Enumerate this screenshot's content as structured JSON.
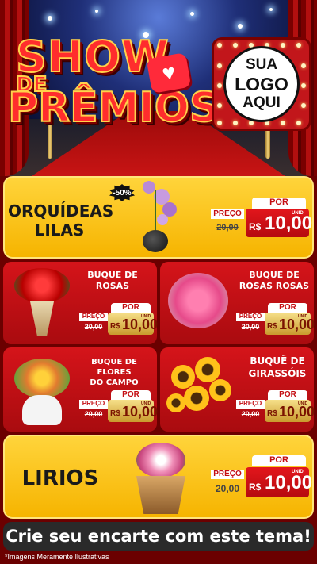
{
  "header": {
    "title_show": "SHOW",
    "title_de": "DE",
    "title_premios": "PRÊMIOS",
    "logo_line1": "SUA",
    "logo_line2": "LOGO",
    "logo_line3": "AQUI",
    "icon": "heart-icon"
  },
  "products": [
    {
      "name_line1": "ORQUÍDEAS",
      "name_line2": "LILAS",
      "discount": "-50%",
      "preco_label": "PREÇO",
      "old_price": "20,00",
      "por_label": "POR",
      "currency": "R$",
      "price": "10,00",
      "unit": "UNID"
    },
    {
      "name_line1": "BUQUE DE",
      "name_line2": "ROSAS",
      "preco_label": "PREÇO",
      "old_price": "20,00",
      "por_label": "POR",
      "currency": "R$",
      "price": "10,00",
      "unit": "UNID"
    },
    {
      "name_line1": "BUQUE DE",
      "name_line2": "ROSAS ROSAS",
      "preco_label": "PREÇO",
      "old_price": "20,00",
      "por_label": "POR",
      "currency": "R$",
      "price": "10,00",
      "unit": "UNID"
    },
    {
      "name_line1": "BUQUE DE FLORES",
      "name_line2": "DO CAMPO",
      "preco_label": "PREÇO",
      "old_price": "20,00",
      "por_label": "POR",
      "currency": "R$",
      "price": "10,00",
      "unit": "UNID"
    },
    {
      "name_line1": "BUQUÊ DE",
      "name_line2": "GIRASSÓIS",
      "preco_label": "PREÇO",
      "old_price": "20,00",
      "por_label": "POR",
      "currency": "R$",
      "price": "10,00",
      "unit": "UNID"
    },
    {
      "name_line1": "LIRIOS",
      "preco_label": "PREÇO",
      "old_price": "20,00",
      "por_label": "POR",
      "currency": "R$",
      "price": "10,00",
      "unit": "UNID"
    }
  ],
  "footer": {
    "cta": "Crie seu encarte com este tema!",
    "disclaimer": "*Imagens Meramente Ilustrativas"
  },
  "colors": {
    "brand_red": "#c40d12",
    "brand_yellow": "#ffd43b",
    "dark_red_bg": "#6b0000"
  }
}
